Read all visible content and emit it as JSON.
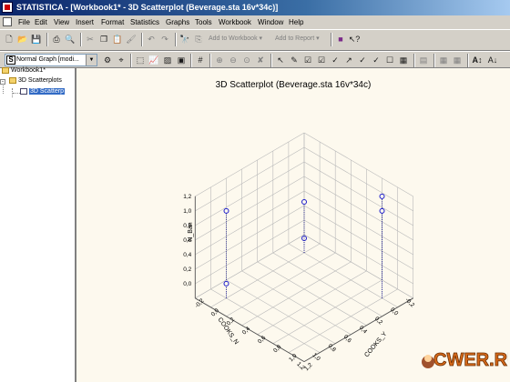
{
  "window": {
    "title": "STATISTICA - [Workbook1* - 3D Scatterplot (Beverage.sta 16v*34c)]"
  },
  "menu": [
    "File",
    "Edit",
    "View",
    "Insert",
    "Format",
    "Statistics",
    "Graphs",
    "Tools",
    "Workbook",
    "Window",
    "Help"
  ],
  "toolbar1": {
    "add_to_workbook": "Add to Workbook",
    "add_to_report": "Add to Report"
  },
  "toolbar2": {
    "graph_type": "Normal Graph [modi...",
    "text_btn": "A"
  },
  "tree": {
    "root": "Workbook1*",
    "folder": "3D Scatterplots",
    "item": "3D Scatterp"
  },
  "graph": {
    "title": "3D Scatterplot (Beverage.sta 16v*34c)",
    "z_label": "N_Ban",
    "x_label": "COOKS_N",
    "y_label": "COOKS_Y",
    "z_ticks": [
      "1,2",
      "1,0",
      "0,8",
      "0,6",
      "0,4",
      "0,2",
      "0,0"
    ],
    "x_ticks": [
      "1,2",
      "1,0",
      "0,8",
      "0,6",
      "0,4",
      "0,2",
      "0,0",
      "-0,2"
    ],
    "y_ticks": [
      "-0,2",
      "0,0",
      "0,2",
      "0,4",
      "0,6",
      "0,8",
      "1,0",
      "1,2"
    ]
  },
  "chart_data": {
    "type": "scatter",
    "title": "3D Scatterplot (Beverage.sta 16v*34c)",
    "xlabel": "COOKS_N",
    "ylabel": "COOKS_Y",
    "zlabel": "N_Ban",
    "xlim": [
      -0.2,
      1.2
    ],
    "ylim": [
      -0.2,
      1.2
    ],
    "zlim": [
      -0.2,
      1.2
    ],
    "grid": true,
    "points": [
      {
        "x": 1.0,
        "y": 0.0,
        "z": 1.0
      },
      {
        "x": 1.0,
        "y": 0.0,
        "z": 0.0
      },
      {
        "x": 0.0,
        "y": 1.0,
        "z": 1.2
      },
      {
        "x": 0.0,
        "y": 0.0,
        "z": 0.0
      },
      {
        "x": 0.0,
        "y": 0.0,
        "z": 0.5
      },
      {
        "x": 0.0,
        "y": 1.0,
        "z": 1.0
      }
    ]
  }
}
